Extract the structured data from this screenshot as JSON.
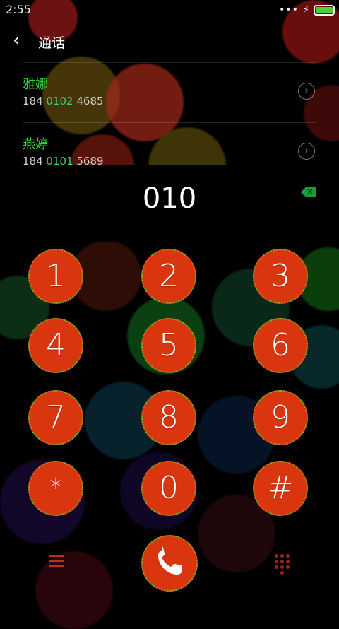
{
  "status": {
    "time": "2:55",
    "dots": "•••",
    "bolt": "⚡"
  },
  "header": {
    "back_glyph": "‹",
    "title": "通话"
  },
  "contacts": [
    {
      "name": "雅娜",
      "number_pre": "184 ",
      "number_match": "0102",
      "number_post": " 4685"
    },
    {
      "name": "燕婷",
      "number_pre": "184 ",
      "number_match": "0101",
      "number_post": " 5689"
    }
  ],
  "dialer": {
    "dialed": "010",
    "keys": [
      "1",
      "2",
      "3",
      "4",
      "5",
      "6",
      "7",
      "8",
      "9",
      "*",
      "0",
      "#"
    ]
  },
  "colors": {
    "accent": "#d9360f",
    "name_green": "#35d23c",
    "match": "#2fd07a"
  }
}
